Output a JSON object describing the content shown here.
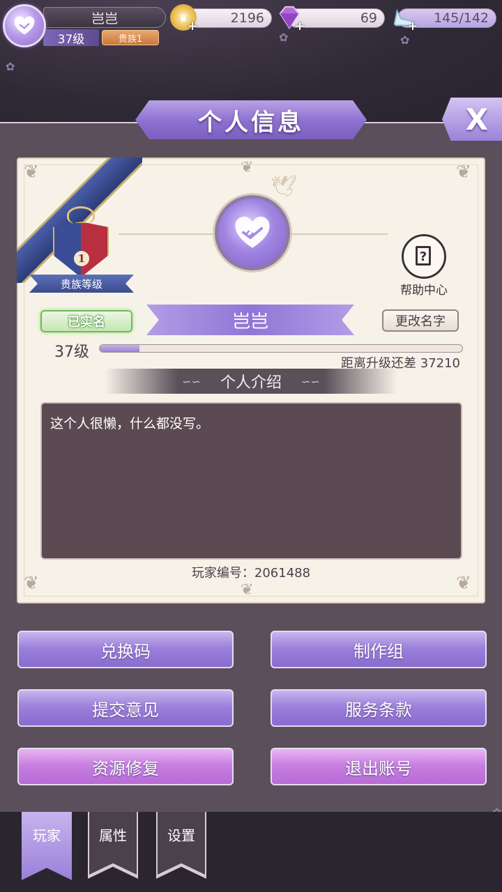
{
  "player": {
    "name": "岂岂",
    "level": "37级",
    "noble": "贵族1",
    "verified": "已实名",
    "id_text": "玩家编号：2061488",
    "exp_remaining": "距离升级还差 37210",
    "exp_progress": 0.11,
    "intro": "这个人很懒，什么都没写。"
  },
  "resources": {
    "gold": "2196",
    "diamond": "69",
    "stamina": "145/142"
  },
  "panel": {
    "title": "个人信息",
    "close": "X",
    "help": "帮助中心",
    "rename": "更改名字",
    "intro_header": "个人介绍",
    "crest_level": "1",
    "crest_label": "贵族等级"
  },
  "buttons": {
    "redeem": "兑换码",
    "credits": "制作组",
    "feedback": "提交意见",
    "terms": "服务条款",
    "repair": "资源修复",
    "logout": "退出账号"
  },
  "tabs": {
    "player": "玩家",
    "attributes": "属性",
    "settings": "设置"
  },
  "colors": {
    "accent_purple": "#9c80db",
    "accent_pink": "#c77fe0",
    "card_bg": "#f7f2e8",
    "panel_bg": "#5a4f5a",
    "verified_green": "#6dbb5a"
  }
}
